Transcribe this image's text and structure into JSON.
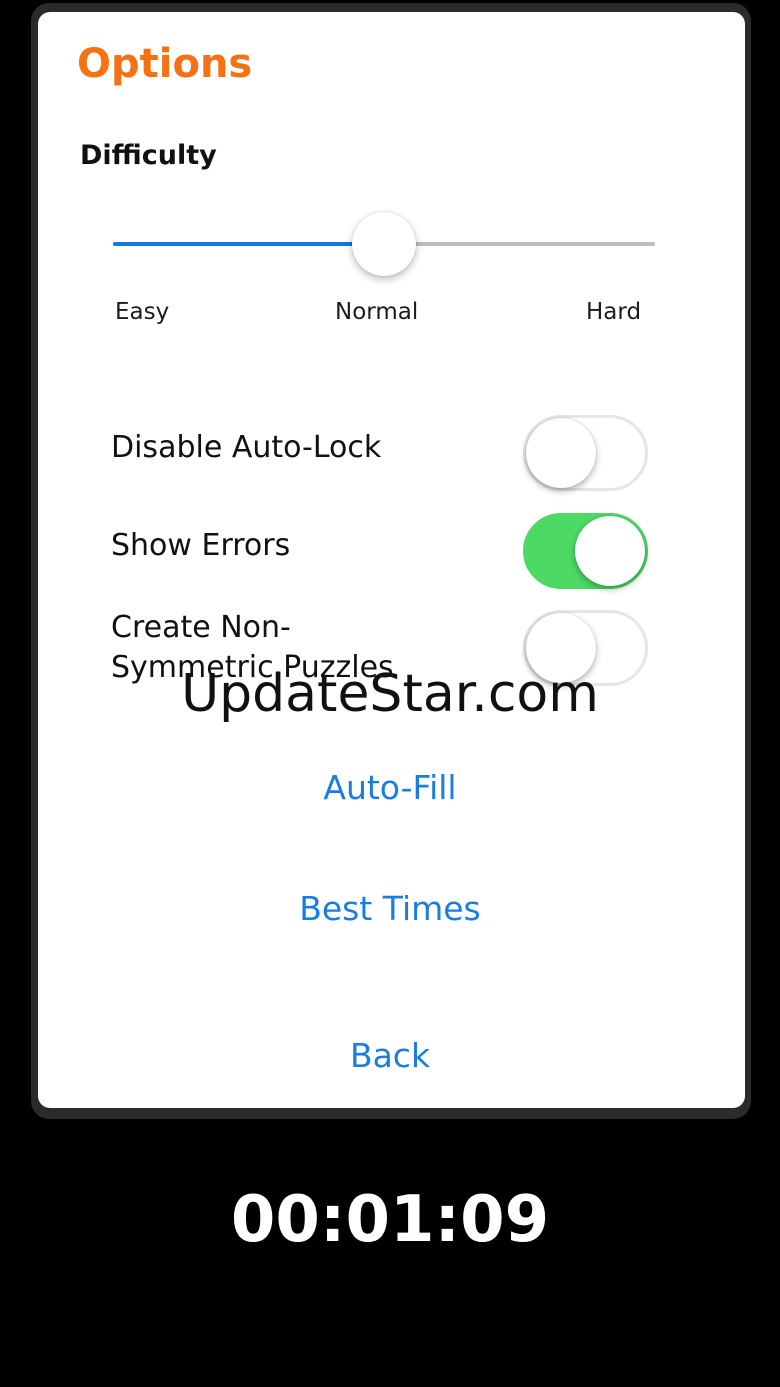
{
  "options": {
    "title": "Options",
    "difficulty": {
      "label": "Difficulty",
      "levels": [
        "Easy",
        "Normal",
        "Hard"
      ],
      "selected": "Normal",
      "slider_value": 0.5
    },
    "toggles": [
      {
        "label": "Disable Auto-Lock",
        "on": false
      },
      {
        "label": "Show Errors",
        "on": true
      },
      {
        "label": "Create Non-Symmetric Puzzles",
        "on": false
      }
    ],
    "buttons": {
      "auto_fill": "Auto-Fill",
      "best_times": "Best Times",
      "back": "Back"
    }
  },
  "timer": "00:01:09",
  "watermark": "UpdateStar.com",
  "colors": {
    "title": "#f47214",
    "link": "#1a7ee0",
    "slider_fill": "#1479e8",
    "toggle_on": "#4cd964"
  }
}
